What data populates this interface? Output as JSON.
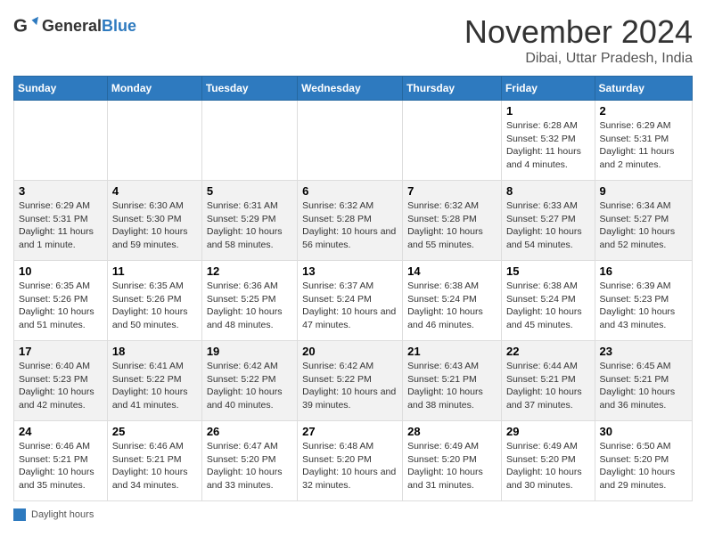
{
  "logo": {
    "text_general": "General",
    "text_blue": "Blue"
  },
  "title": "November 2024",
  "location": "Dibai, Uttar Pradesh, India",
  "days_of_week": [
    "Sunday",
    "Monday",
    "Tuesday",
    "Wednesday",
    "Thursday",
    "Friday",
    "Saturday"
  ],
  "legend_label": "Daylight hours",
  "weeks": [
    {
      "days": [
        {
          "number": "",
          "info": ""
        },
        {
          "number": "",
          "info": ""
        },
        {
          "number": "",
          "info": ""
        },
        {
          "number": "",
          "info": ""
        },
        {
          "number": "",
          "info": ""
        },
        {
          "number": "1",
          "info": "Sunrise: 6:28 AM\nSunset: 5:32 PM\nDaylight: 11 hours and 4 minutes."
        },
        {
          "number": "2",
          "info": "Sunrise: 6:29 AM\nSunset: 5:31 PM\nDaylight: 11 hours and 2 minutes."
        }
      ]
    },
    {
      "days": [
        {
          "number": "3",
          "info": "Sunrise: 6:29 AM\nSunset: 5:31 PM\nDaylight: 11 hours and 1 minute."
        },
        {
          "number": "4",
          "info": "Sunrise: 6:30 AM\nSunset: 5:30 PM\nDaylight: 10 hours and 59 minutes."
        },
        {
          "number": "5",
          "info": "Sunrise: 6:31 AM\nSunset: 5:29 PM\nDaylight: 10 hours and 58 minutes."
        },
        {
          "number": "6",
          "info": "Sunrise: 6:32 AM\nSunset: 5:28 PM\nDaylight: 10 hours and 56 minutes."
        },
        {
          "number": "7",
          "info": "Sunrise: 6:32 AM\nSunset: 5:28 PM\nDaylight: 10 hours and 55 minutes."
        },
        {
          "number": "8",
          "info": "Sunrise: 6:33 AM\nSunset: 5:27 PM\nDaylight: 10 hours and 54 minutes."
        },
        {
          "number": "9",
          "info": "Sunrise: 6:34 AM\nSunset: 5:27 PM\nDaylight: 10 hours and 52 minutes."
        }
      ]
    },
    {
      "days": [
        {
          "number": "10",
          "info": "Sunrise: 6:35 AM\nSunset: 5:26 PM\nDaylight: 10 hours and 51 minutes."
        },
        {
          "number": "11",
          "info": "Sunrise: 6:35 AM\nSunset: 5:26 PM\nDaylight: 10 hours and 50 minutes."
        },
        {
          "number": "12",
          "info": "Sunrise: 6:36 AM\nSunset: 5:25 PM\nDaylight: 10 hours and 48 minutes."
        },
        {
          "number": "13",
          "info": "Sunrise: 6:37 AM\nSunset: 5:24 PM\nDaylight: 10 hours and 47 minutes."
        },
        {
          "number": "14",
          "info": "Sunrise: 6:38 AM\nSunset: 5:24 PM\nDaylight: 10 hours and 46 minutes."
        },
        {
          "number": "15",
          "info": "Sunrise: 6:38 AM\nSunset: 5:24 PM\nDaylight: 10 hours and 45 minutes."
        },
        {
          "number": "16",
          "info": "Sunrise: 6:39 AM\nSunset: 5:23 PM\nDaylight: 10 hours and 43 minutes."
        }
      ]
    },
    {
      "days": [
        {
          "number": "17",
          "info": "Sunrise: 6:40 AM\nSunset: 5:23 PM\nDaylight: 10 hours and 42 minutes."
        },
        {
          "number": "18",
          "info": "Sunrise: 6:41 AM\nSunset: 5:22 PM\nDaylight: 10 hours and 41 minutes."
        },
        {
          "number": "19",
          "info": "Sunrise: 6:42 AM\nSunset: 5:22 PM\nDaylight: 10 hours and 40 minutes."
        },
        {
          "number": "20",
          "info": "Sunrise: 6:42 AM\nSunset: 5:22 PM\nDaylight: 10 hours and 39 minutes."
        },
        {
          "number": "21",
          "info": "Sunrise: 6:43 AM\nSunset: 5:21 PM\nDaylight: 10 hours and 38 minutes."
        },
        {
          "number": "22",
          "info": "Sunrise: 6:44 AM\nSunset: 5:21 PM\nDaylight: 10 hours and 37 minutes."
        },
        {
          "number": "23",
          "info": "Sunrise: 6:45 AM\nSunset: 5:21 PM\nDaylight: 10 hours and 36 minutes."
        }
      ]
    },
    {
      "days": [
        {
          "number": "24",
          "info": "Sunrise: 6:46 AM\nSunset: 5:21 PM\nDaylight: 10 hours and 35 minutes."
        },
        {
          "number": "25",
          "info": "Sunrise: 6:46 AM\nSunset: 5:21 PM\nDaylight: 10 hours and 34 minutes."
        },
        {
          "number": "26",
          "info": "Sunrise: 6:47 AM\nSunset: 5:20 PM\nDaylight: 10 hours and 33 minutes."
        },
        {
          "number": "27",
          "info": "Sunrise: 6:48 AM\nSunset: 5:20 PM\nDaylight: 10 hours and 32 minutes."
        },
        {
          "number": "28",
          "info": "Sunrise: 6:49 AM\nSunset: 5:20 PM\nDaylight: 10 hours and 31 minutes."
        },
        {
          "number": "29",
          "info": "Sunrise: 6:49 AM\nSunset: 5:20 PM\nDaylight: 10 hours and 30 minutes."
        },
        {
          "number": "30",
          "info": "Sunrise: 6:50 AM\nSunset: 5:20 PM\nDaylight: 10 hours and 29 minutes."
        }
      ]
    }
  ]
}
